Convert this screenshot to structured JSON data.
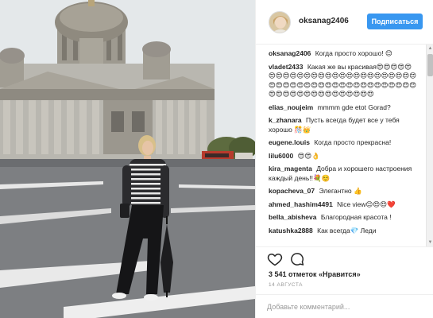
{
  "post": {
    "username": "oksanag2406",
    "follow_label": "Подписаться"
  },
  "comments": [
    {
      "user": "oksanag2406",
      "text": "Когда просто хорошо! 😊"
    },
    {
      "user": "vladet2433",
      "text": "Какая же вы красивая😍😍😍😍😍😍😍😍😍😍😍😍😍😍😍😍😍😍😍😍😍😍😍😍😍😍😍😍😍😍😍😍😍😍😍😍😍😍😍😍😍😍😍😍😍😍😍😍😍😍😍😍😍😍😍😍😍😍😍😍😍😍"
    },
    {
      "user": "elias_noujeim",
      "text": "mmmm gde etot Gorad?"
    },
    {
      "user": "k_zhanara",
      "text": "Пусть всегда будет все у тебя хорошо 🎊👑"
    },
    {
      "user": "eugene.louis",
      "text": "Когда просто прекрасна!"
    },
    {
      "user": "lilu6000",
      "text": "😍😍👌"
    },
    {
      "user": "kira_magenta",
      "text": "Добра и хорошего настроения каждый день!!💐☺️"
    },
    {
      "user": "kopacheva_07",
      "text": "Элегантно 👍"
    },
    {
      "user": "ahmed_hashim4491",
      "text": "Nice view😊😍😍❤️"
    },
    {
      "user": "bella_abisheva",
      "text": "Благородная красота !"
    },
    {
      "user": "katushka2888",
      "text": "Как всегда💎 Леди"
    }
  ],
  "actions": {
    "like_icon": "heart-icon",
    "comment_icon": "speech-bubble-icon"
  },
  "likes": {
    "count": "3 541",
    "label": "отметок «Нравится»"
  },
  "date": "14 АВГУСТА",
  "add_comment": {
    "placeholder": "Добавьте комментарий..."
  },
  "colors": {
    "follow_button": "#3897f0",
    "border": "#efefef",
    "muted_text": "#999999",
    "primary_text": "#262626"
  }
}
